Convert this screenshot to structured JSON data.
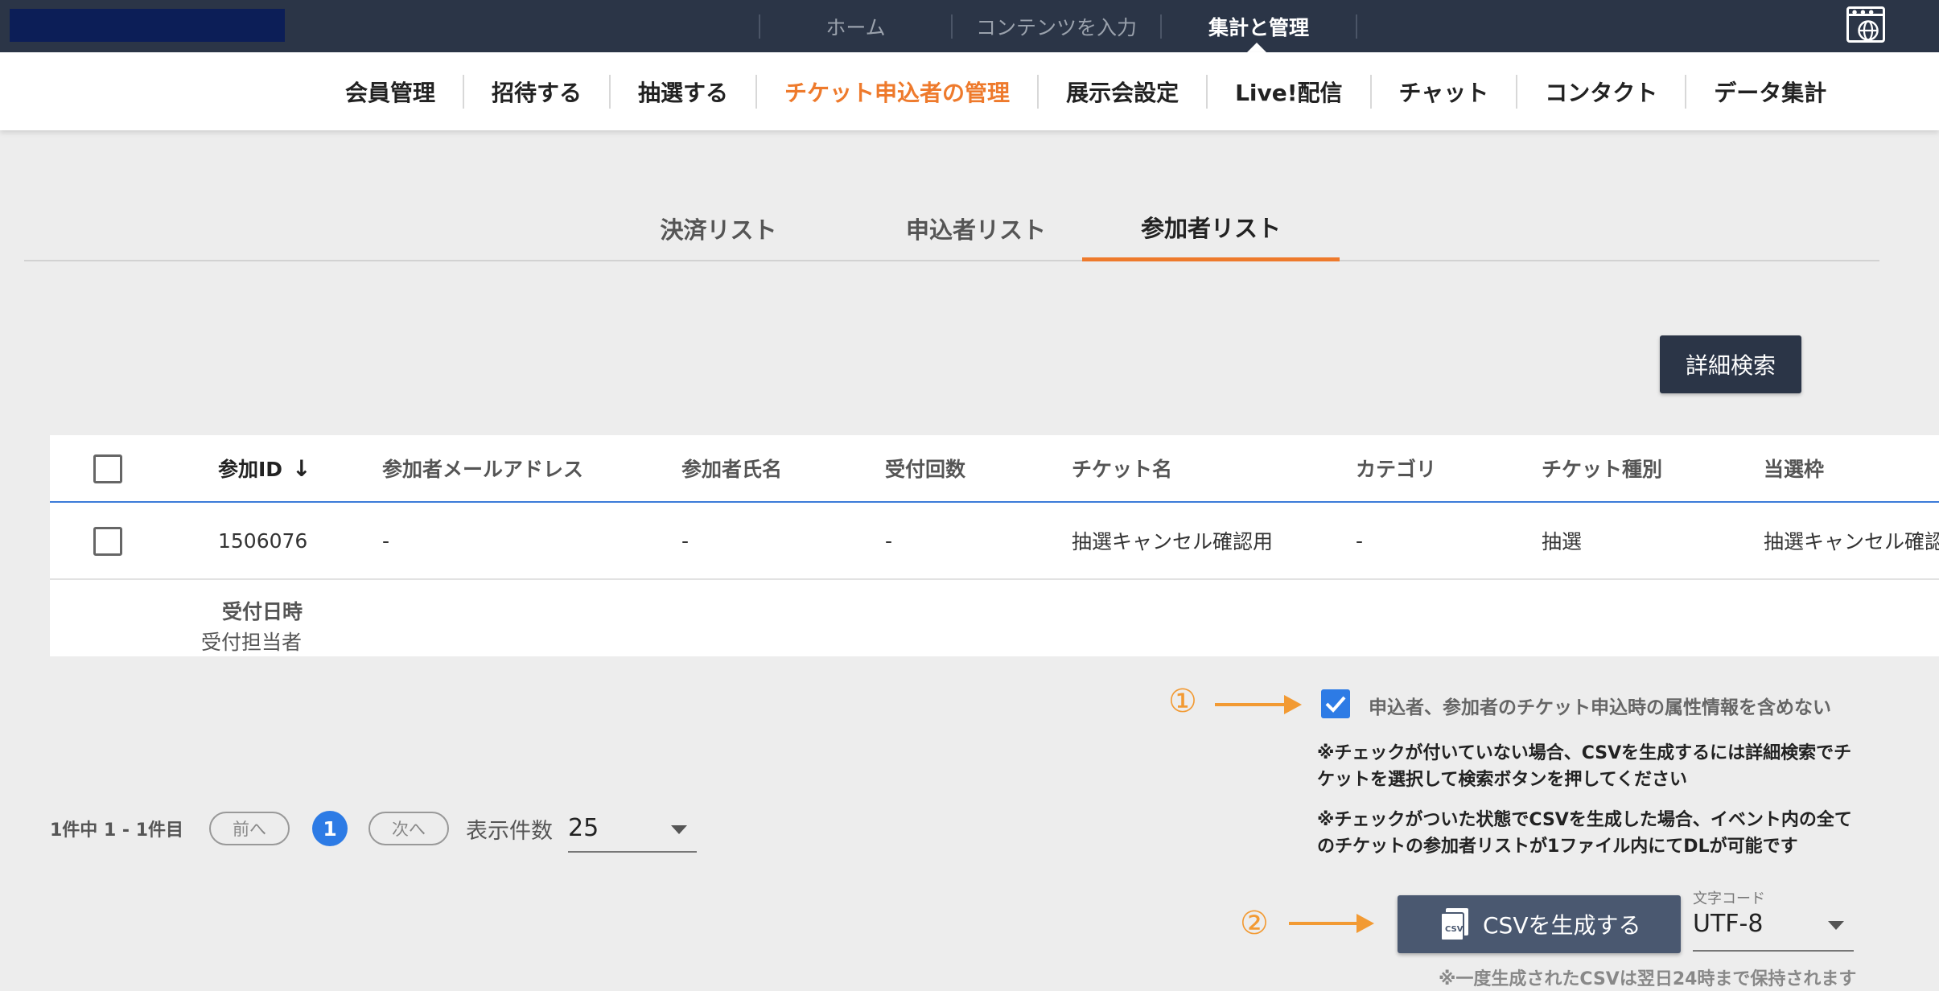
{
  "top_nav": {
    "items": [
      "ホーム",
      "コンテンツを入力",
      "集計と管理"
    ],
    "active_index": 2
  },
  "main_nav": {
    "items": [
      "会員管理",
      "招待する",
      "抽選する",
      "チケット申込者の管理",
      "展示会設定",
      "Live!配信",
      "チャット",
      "コンタクト",
      "データ集計"
    ],
    "active_index": 3
  },
  "tabs": [
    "決済リスト",
    "申込者リスト",
    "参加者リスト"
  ],
  "active_tab_index": 2,
  "advanced_search_label": "詳細検索",
  "table": {
    "columns": [
      "参加ID",
      "参加者メールアドレス",
      "参加者氏名",
      "受付回数",
      "チケット名",
      "カテゴリ",
      "チケット種別",
      "当選枠"
    ],
    "sort_arrow": "↓",
    "rows": [
      {
        "id": "1506076",
        "email": "-",
        "name": "-",
        "count": "-",
        "ticket": "抽選キャンセル確認用",
        "category": "-",
        "type": "抽選",
        "slot": "抽選キャンセル確認用"
      }
    ],
    "sub_labels": [
      "受付日時",
      "受付担当者"
    ]
  },
  "pagination": {
    "summary": "1件中 1 - 1件目",
    "prev": "前へ",
    "page": "1",
    "next": "次へ",
    "per_page_label": "表示件数",
    "per_page_value": "25"
  },
  "annotations": {
    "step1": "①",
    "step2": "②"
  },
  "csv_options": {
    "exclude_attrs_label": "申込者、参加者のチケット申込時の属性情報を含めない",
    "exclude_attrs_checked": true,
    "note_unchecked": "※チェックが付いていない場合、CSVを生成するには詳細検索でチケットを選択して検索ボタンを押してください",
    "note_checked": "※チェックがついた状態でCSVを生成した場合、イベント内の全てのチケットの参加者リストが1ファイル内にてDLが可能です",
    "generate_label": "CSVを生成する",
    "csv_icon_text": "CSV",
    "encoding_label": "文字コード",
    "encoding_value": "UTF-8",
    "retention_note": "※一度生成されたCSVは翌日24時まで保持されます"
  },
  "colors": {
    "topbar": "#2b3547",
    "accent_orange": "#ee7a2c",
    "primary_blue": "#2d7be5",
    "annotation_orange": "#f29a33"
  }
}
